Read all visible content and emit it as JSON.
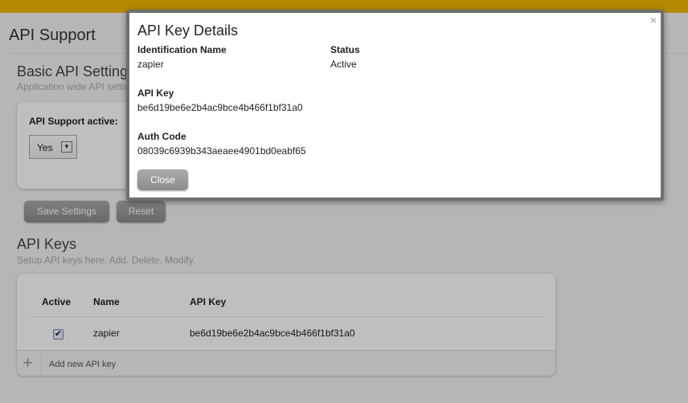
{
  "page": {
    "title": "API Support",
    "basic_settings": {
      "title": "Basic API Settings",
      "subtitle": "Application wide API settings",
      "field_label": "API Support active:",
      "select_value": "Yes"
    },
    "buttons": {
      "save": "Save Settings",
      "reset": "Reset"
    },
    "api_keys": {
      "title": "API Keys",
      "subtitle": "Setup API keys here. Add. Delete. Modify.",
      "columns": [
        "Active",
        "Name",
        "API Key"
      ],
      "rows": [
        {
          "active": true,
          "name": "zapier",
          "api_key": "be6d19be6e2b4ac9bce4b466f1bf31a0"
        }
      ],
      "add_label": "Add new API key"
    }
  },
  "modal": {
    "title": "API Key Details",
    "close_glyph": "×",
    "identification_label": "Identification Name",
    "identification_value": "zapier",
    "status_label": "Status",
    "status_value": "Active",
    "api_key_label": "API Key",
    "api_key_value": "be6d19be6e2b4ac9bce4b466f1bf31a0",
    "auth_code_label": "Auth Code",
    "auth_code_value": "08039c6939b343aeaee4901bd0eabf65",
    "close_button": "Close"
  },
  "colors": {
    "topbar": "#f2b705",
    "button": "#9e9e9e"
  }
}
